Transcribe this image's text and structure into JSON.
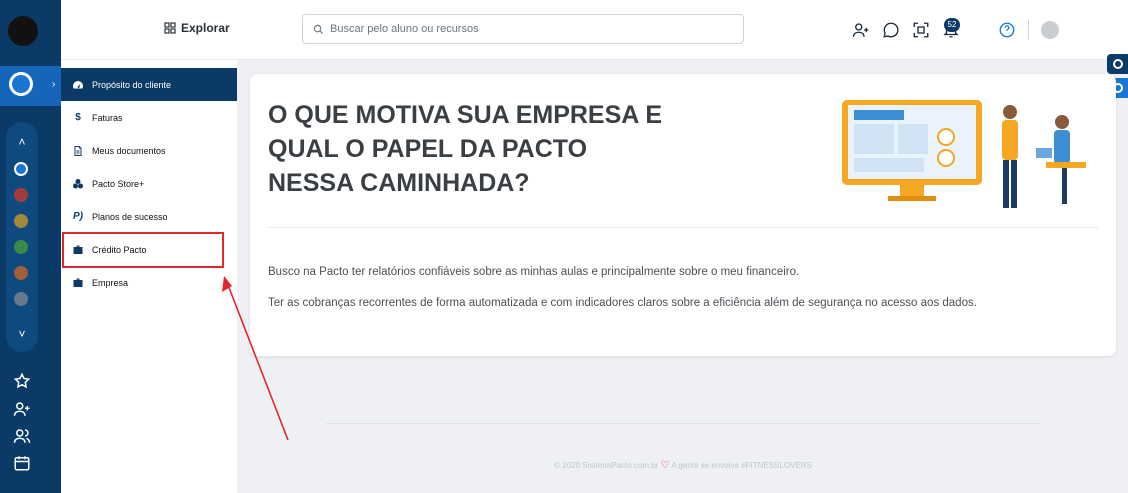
{
  "topbar": {
    "explorar_label": "Explorar",
    "search_placeholder": "Buscar pelo aluno ou recursos",
    "notification_count": "52"
  },
  "sidebar": {
    "items": [
      {
        "label": "Propósito do cliente",
        "icon": "dashboard-icon",
        "active": true
      },
      {
        "label": "Faturas",
        "icon": "dollar-icon"
      },
      {
        "label": "Meus documentos",
        "icon": "document-icon"
      },
      {
        "label": "Pacto Store+",
        "icon": "store-icon"
      },
      {
        "label": "Planos de sucesso",
        "icon": "pacto-icon"
      },
      {
        "label": "Crédito Pacto",
        "icon": "briefcase-icon"
      },
      {
        "label": "Empresa",
        "icon": "briefcase-icon"
      }
    ]
  },
  "card": {
    "title_line1": "O QUE MOTIVA SUA EMPRESA E",
    "title_line2": "QUAL O PAPEL DA PACTO",
    "title_line3": "NESSA CAMINHADA?",
    "paragraph1": "Busco na Pacto ter relatórios confiáveis sobre as minhas aulas e principalmente sobre o meu financeiro.",
    "paragraph2": "Ter as cobranças recorrentes de forma automatizada e com indicadores claros sobre a eficiência além de segurança no acesso aos dados."
  },
  "footer": {
    "left": "© 2020 SistemaPacto.com.br",
    "right": "A gente se envolve #FITNESSLOVERS"
  },
  "colors": {
    "primary": "#0b3a66",
    "accent": "#1976d2",
    "highlight": "#e3262b"
  }
}
